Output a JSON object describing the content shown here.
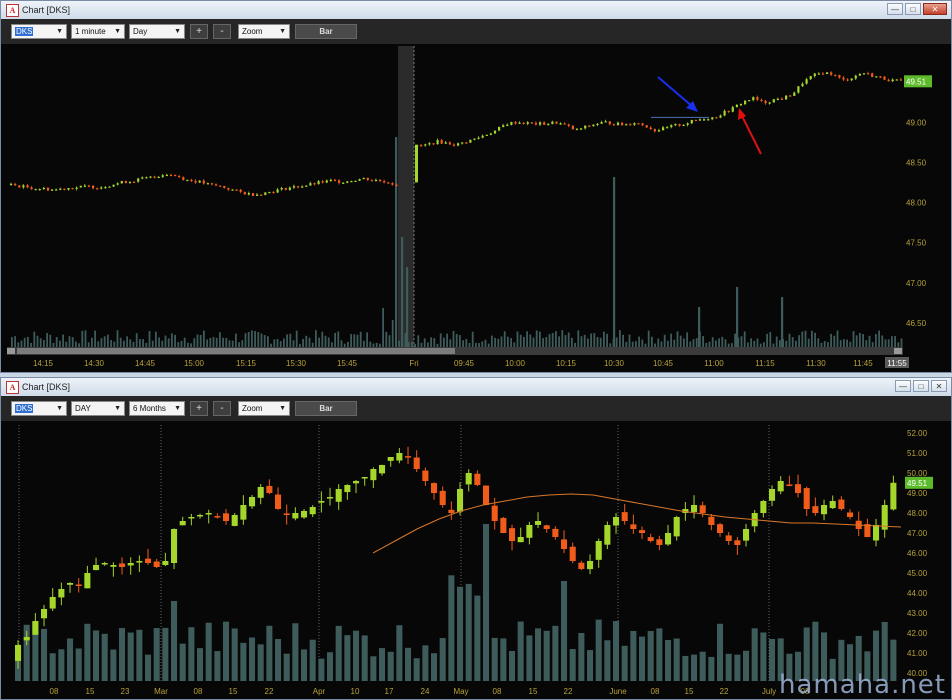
{
  "top_window": {
    "title": "Chart [DKS]",
    "symbol": "DKS",
    "interval": "1 minute",
    "period": "Day",
    "plus": "+",
    "minus": "-",
    "zoom": "Zoom",
    "bar": "Bar",
    "last_price_tag": "49.51",
    "time_tag": "11:55"
  },
  "bottom_window": {
    "title": "Chart [DKS]",
    "symbol": "DKS",
    "interval": "DAY",
    "period": "6 Months",
    "plus": "+",
    "minus": "-",
    "zoom": "Zoom",
    "bar": "Bar",
    "last_price_tag": "49.51"
  },
  "watermark": "hamaha.net",
  "chart_data": [
    {
      "type": "candlestick",
      "title": "Chart [DKS]",
      "interval": "1 minute",
      "x_tick_labels": [
        "14:15",
        "14:30",
        "14:45",
        "15:00",
        "15:15",
        "15:30",
        "15:45",
        "Fri",
        "09:45",
        "10:00",
        "10:15",
        "10:30",
        "10:45",
        "11:00",
        "11:15",
        "11:30",
        "11:45"
      ],
      "y_tick_labels": [
        "49.00",
        "48.50",
        "48.00",
        "47.50",
        "47.00",
        "46.50"
      ],
      "ylim": [
        46.2,
        49.95
      ],
      "prev_day_path": [
        48.22,
        48.2,
        48.18,
        48.17,
        48.16,
        48.18,
        48.19,
        48.2,
        48.19,
        48.22,
        48.25,
        48.27,
        48.3,
        48.32,
        48.36,
        48.33,
        48.28,
        48.26,
        48.22,
        48.2,
        48.16,
        48.12,
        48.1,
        48.12,
        48.15,
        48.18,
        48.2,
        48.22,
        48.25,
        48.27,
        48.26,
        48.28,
        48.3,
        48.28,
        48.26,
        48.22
      ],
      "today_path": [
        48.7,
        48.72,
        48.76,
        48.74,
        48.72,
        48.76,
        48.8,
        48.85,
        48.9,
        48.98,
        49.0,
        48.99,
        48.98,
        48.98,
        49.0,
        48.96,
        48.9,
        48.94,
        48.98,
        49.0,
        48.98,
        48.97,
        49.0,
        48.96,
        48.9,
        48.92,
        48.96,
        48.98,
        49.02,
        49.05,
        49.06,
        49.12,
        49.18,
        49.26,
        49.3,
        49.24,
        49.28,
        49.3,
        49.36,
        49.5,
        49.58,
        49.62,
        49.6,
        49.52,
        49.56,
        49.62,
        49.58,
        49.55,
        49.52,
        49.51
      ],
      "annotations": [
        "blue arrow",
        "red arrow"
      ]
    },
    {
      "type": "candlestick",
      "title": "Chart [DKS]",
      "interval": "DAY",
      "period": "6 Months",
      "x_tick_labels": [
        "08",
        "15",
        "23",
        "Mar",
        "08",
        "15",
        "22",
        "Apr",
        "10",
        "17",
        "24",
        "May",
        "08",
        "15",
        "22",
        "June",
        "08",
        "15",
        "22",
        "July",
        "08"
      ],
      "y_tick_labels": [
        "52.00",
        "51.00",
        "50.00",
        "49.00",
        "48.00",
        "47.00",
        "46.00",
        "45.00",
        "44.00",
        "43.00",
        "42.00",
        "41.00",
        "40.00"
      ],
      "ylim": [
        39.6,
        52.4
      ],
      "close_path": [
        41.4,
        41.8,
        42.6,
        43.2,
        43.8,
        44.2,
        44.5,
        44.4,
        45.0,
        45.4,
        45.5,
        45.4,
        45.3,
        45.5,
        45.6,
        45.5,
        45.3,
        45.6,
        47.2,
        47.6,
        47.8,
        47.9,
        48.0,
        47.8,
        47.6,
        47.9,
        48.4,
        48.8,
        49.3,
        49.0,
        48.2,
        47.9,
        48.0,
        48.1,
        48.3,
        48.6,
        48.8,
        49.2,
        49.4,
        49.6,
        49.8,
        50.2,
        50.4,
        50.8,
        51.0,
        50.8,
        50.2,
        49.6,
        49.0,
        48.4,
        48.0,
        49.2,
        50.0,
        49.4,
        48.4,
        47.6,
        47.0,
        46.6,
        46.8,
        47.4,
        47.6,
        47.2,
        46.8,
        46.2,
        45.6,
        45.2,
        45.6,
        46.6,
        47.4,
        47.8,
        47.6,
        47.2,
        47.0,
        46.6,
        46.4,
        47.0,
        47.8,
        48.2,
        48.4,
        48.0,
        47.4,
        47.0,
        46.6,
        46.4,
        47.2,
        48.0,
        48.6,
        49.2,
        49.6,
        49.4,
        49.0,
        48.2,
        48.0,
        48.4,
        48.6,
        48.2,
        47.8,
        47.2,
        46.8,
        47.4,
        48.4,
        49.51
      ],
      "ma_path": [
        46.0,
        46.6,
        47.2,
        47.7,
        48.1,
        48.4,
        48.6,
        48.8,
        48.9,
        48.95,
        48.9,
        48.7,
        48.5,
        48.3,
        48.1,
        47.95,
        47.8,
        47.7,
        47.6,
        47.5,
        47.5,
        47.45,
        47.4,
        47.35,
        47.3
      ]
    }
  ],
  "colors": {
    "up": "#a4d62b",
    "down": "#f15c1a",
    "volume": "#3e5c5c",
    "ma": "#d9772a",
    "axis_text": "#b8a23a",
    "price_tag": "#5dbb2b"
  }
}
